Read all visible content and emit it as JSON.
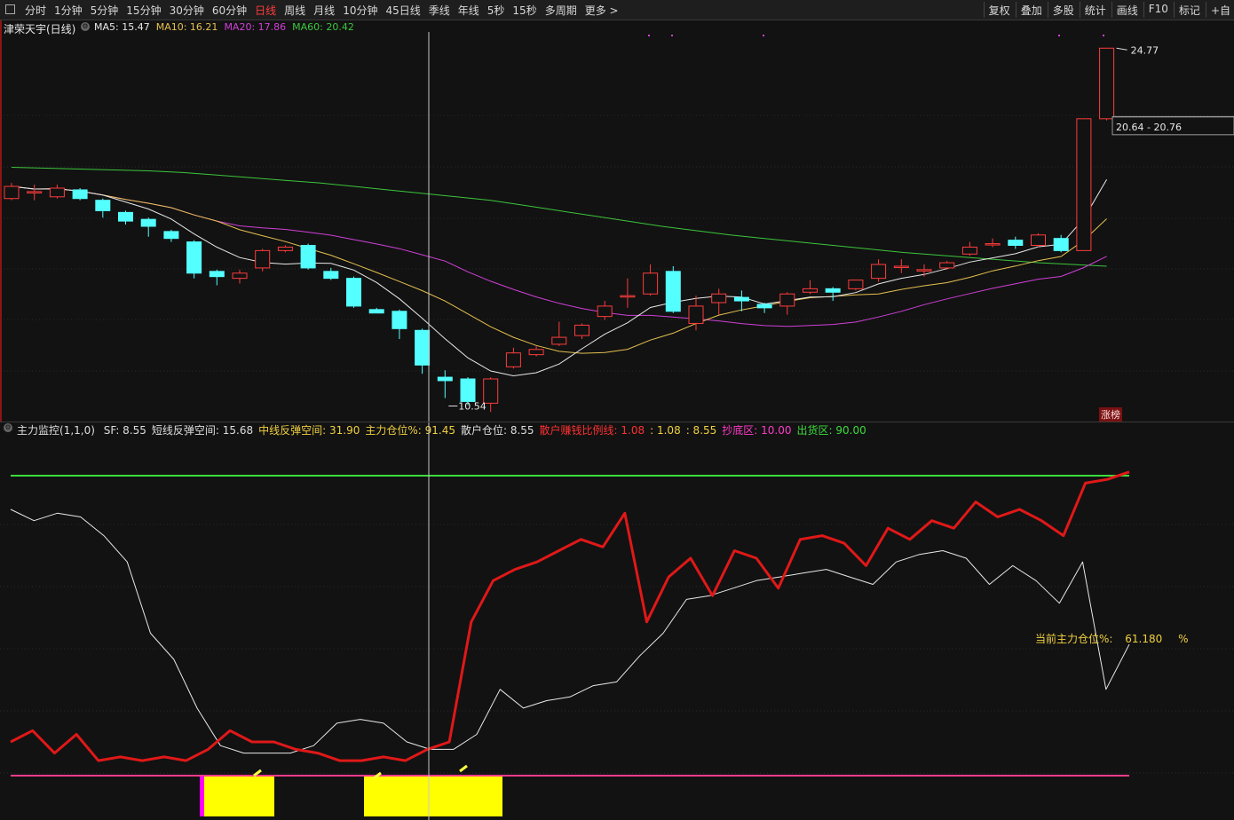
{
  "toolbar": {
    "periods": [
      "分时",
      "1分钟",
      "5分钟",
      "15分钟",
      "30分钟",
      "60分钟",
      "日线",
      "周线",
      "月线",
      "10分钟",
      "45日线",
      "季线",
      "年线",
      "5秒",
      "15秒",
      "多周期",
      "更多 >"
    ],
    "active": "日线",
    "right": [
      "复权",
      "叠加",
      "多股",
      "统计",
      "画线",
      "F10",
      "标记",
      "+自"
    ]
  },
  "main_chart": {
    "title": "津荣天宇(日线)",
    "ma_labels": [
      {
        "text": "MA5: 15.47",
        "color": "#e8e8e8"
      },
      {
        "text": "MA10: 16.21",
        "color": "#e6c050"
      },
      {
        "text": "MA20: 17.86",
        "color": "#d040d8"
      },
      {
        "text": "MA60: 20.42",
        "color": "#3cc63c"
      }
    ],
    "high_label": "24.77",
    "low_label": "10.54",
    "range_label": "20.64 - 20.76",
    "badge": "涨榜",
    "colors": {
      "up": "#ff3c3c",
      "down": "#54ffff",
      "ma5": "#e8e8e8",
      "ma10": "#e6c050",
      "ma20": "#d040d8",
      "ma60": "#3cc63c"
    }
  },
  "indicator": {
    "name": "主力监控(1,1,0)",
    "items": [
      {
        "text": "SF: 8.55",
        "color": "#dddddd"
      },
      {
        "text": "短线反弹空间: 15.68",
        "color": "#dddddd"
      },
      {
        "text": "中线反弹空间: 31.90",
        "color": "#f0d040"
      },
      {
        "text": "主力仓位%: 91.45",
        "color": "#f0d040"
      },
      {
        "text": "散户仓位: 8.55",
        "color": "#dddddd"
      },
      {
        "text": "散户赚钱比例线: 1.08",
        "color": "#ff3030"
      },
      {
        "text": ": 1.08",
        "color": "#f0d040"
      },
      {
        "text": ": 8.55",
        "color": "#f0d040"
      },
      {
        "text": "抄底区: 10.00",
        "color": "#ff3cc8"
      },
      {
        "text": "出货区: 90.00",
        "color": "#3cdc3c"
      }
    ],
    "current_label": "当前主力仓位%:",
    "current_value": "61.180",
    "current_unit": "%"
  },
  "chart_data": [
    {
      "type": "candlestick",
      "title": "津荣天宇(日线)",
      "candles": [
        {
          "o": 16.1,
          "c": 16.8,
          "h": 17.0,
          "l": 16.0
        },
        {
          "o": 16.5,
          "c": 16.5,
          "h": 16.9,
          "l": 16.0
        },
        {
          "o": 16.2,
          "c": 16.7,
          "h": 16.9,
          "l": 16.1
        },
        {
          "o": 16.6,
          "c": 16.1,
          "h": 16.7,
          "l": 16.0
        },
        {
          "o": 16.0,
          "c": 15.4,
          "h": 16.1,
          "l": 15.0
        },
        {
          "o": 15.3,
          "c": 14.8,
          "h": 15.4,
          "l": 14.6
        },
        {
          "o": 14.9,
          "c": 14.5,
          "h": 15.0,
          "l": 13.9
        },
        {
          "o": 14.2,
          "c": 13.8,
          "h": 14.3,
          "l": 13.6
        },
        {
          "o": 13.6,
          "c": 11.8,
          "h": 13.7,
          "l": 11.5
        },
        {
          "o": 11.9,
          "c": 11.6,
          "h": 12.0,
          "l": 11.1
        },
        {
          "o": 11.5,
          "c": 11.8,
          "h": 12.0,
          "l": 11.2
        },
        {
          "o": 12.1,
          "c": 13.1,
          "h": 13.2,
          "l": 11.9
        },
        {
          "o": 13.1,
          "c": 13.3,
          "h": 13.4,
          "l": 13.0
        },
        {
          "o": 13.4,
          "c": 12.1,
          "h": 13.5,
          "l": 12.0
        },
        {
          "o": 11.9,
          "c": 11.5,
          "h": 12.1,
          "l": 11.4
        },
        {
          "o": 11.5,
          "c": 9.9,
          "h": 11.6,
          "l": 9.8
        },
        {
          "o": 9.7,
          "c": 9.5,
          "h": 9.8,
          "l": 9.5
        },
        {
          "o": 9.6,
          "c": 8.6,
          "h": 9.7,
          "l": 8.0
        },
        {
          "o": 8.5,
          "c": 6.5,
          "h": 8.6,
          "l": 6.0
        },
        {
          "o": 5.8,
          "c": 5.6,
          "h": 6.2,
          "l": 4.6
        },
        {
          "o": 5.7,
          "c": 4.4,
          "h": 5.8,
          "l": 4.2
        },
        {
          "o": 4.3,
          "c": 5.7,
          "h": 5.8,
          "l": 3.8
        },
        {
          "o": 6.4,
          "c": 7.2,
          "h": 7.5,
          "l": 6.3
        },
        {
          "o": 7.1,
          "c": 7.4,
          "h": 7.6,
          "l": 7.0
        },
        {
          "o": 7.7,
          "c": 8.1,
          "h": 9.0,
          "l": 7.6
        },
        {
          "o": 8.2,
          "c": 8.8,
          "h": 8.9,
          "l": 8.0
        },
        {
          "o": 9.3,
          "c": 9.9,
          "h": 10.2,
          "l": 9.1
        },
        {
          "o": 10.5,
          "c": 10.5,
          "h": 11.5,
          "l": 9.8
        },
        {
          "o": 10.6,
          "c": 11.8,
          "h": 12.3,
          "l": 10.5
        },
        {
          "o": 11.9,
          "c": 9.6,
          "h": 12.2,
          "l": 9.5
        },
        {
          "o": 8.9,
          "c": 9.9,
          "h": 10.5,
          "l": 8.5
        },
        {
          "o": 10.1,
          "c": 10.6,
          "h": 10.9,
          "l": 9.4
        },
        {
          "o": 10.4,
          "c": 10.2,
          "h": 10.8,
          "l": 9.6
        },
        {
          "o": 10.0,
          "c": 9.8,
          "h": 10.1,
          "l": 9.5
        },
        {
          "o": 9.9,
          "c": 10.6,
          "h": 10.7,
          "l": 9.4
        },
        {
          "o": 10.7,
          "c": 10.9,
          "h": 11.4,
          "l": 10.6
        },
        {
          "o": 10.9,
          "c": 10.7,
          "h": 11.0,
          "l": 10.2
        },
        {
          "o": 10.9,
          "c": 11.4,
          "h": 11.4,
          "l": 10.8
        },
        {
          "o": 11.5,
          "c": 12.3,
          "h": 12.6,
          "l": 11.3
        },
        {
          "o": 12.2,
          "c": 12.2,
          "h": 12.6,
          "l": 11.8
        },
        {
          "o": 12.0,
          "c": 12.0,
          "h": 12.3,
          "l": 11.6
        },
        {
          "o": 12.1,
          "c": 12.4,
          "h": 12.5,
          "l": 12.0
        },
        {
          "o": 12.9,
          "c": 13.3,
          "h": 13.6,
          "l": 12.8
        },
        {
          "o": 13.5,
          "c": 13.5,
          "h": 13.8,
          "l": 13.3
        },
        {
          "o": 13.7,
          "c": 13.4,
          "h": 13.9,
          "l": 13.2
        },
        {
          "o": 13.4,
          "c": 14.0,
          "h": 14.1,
          "l": 13.3
        },
        {
          "o": 13.8,
          "c": 13.1,
          "h": 14.0,
          "l": 13.0
        },
        {
          "o": 13.1,
          "c": 20.7,
          "h": 20.7,
          "l": 13.1
        },
        {
          "o": 20.7,
          "c": 24.77,
          "h": 24.77,
          "l": 20.6
        }
      ],
      "ma60": [
        17.9,
        17.85,
        17.8,
        17.75,
        17.7,
        17.6,
        17.45,
        17.3,
        17.15,
        17.0,
        16.8,
        16.6,
        16.4,
        16.2,
        16.0,
        15.7,
        15.4,
        15.1,
        14.8,
        14.5,
        14.25,
        14.0,
        13.8,
        13.6,
        13.4,
        13.2,
        13.0,
        12.85,
        12.7,
        12.55,
        12.4,
        12.3,
        12.2
      ],
      "ylim": [
        3.5,
        25.5
      ]
    },
    {
      "type": "line",
      "title": "主力监控(1,1,0)",
      "series": [
        {
          "name": "散户仓位",
          "values": [
            81,
            78,
            80,
            79,
            74,
            67,
            48,
            41,
            28,
            18,
            16,
            16,
            16,
            18,
            24,
            25,
            24,
            19,
            17,
            17,
            21,
            33,
            28,
            30,
            31,
            34,
            35,
            42,
            48,
            57,
            58,
            60,
            62,
            63,
            64,
            65,
            63,
            61,
            67,
            69,
            70,
            68,
            61,
            66,
            62,
            56,
            67,
            33,
            45
          ]
        },
        {
          "name": "主力仓位%",
          "values": [
            19,
            22,
            16,
            21,
            14,
            15,
            14,
            15,
            14,
            17,
            22,
            19,
            19,
            17,
            16,
            14,
            14,
            15,
            14,
            17,
            19,
            51,
            62,
            65,
            67,
            70,
            73,
            71,
            80,
            51,
            63,
            68,
            58,
            70,
            68,
            60,
            73,
            74,
            72,
            66,
            76,
            73,
            78,
            76,
            83,
            79,
            81,
            78,
            74,
            88,
            89,
            91
          ]
        }
      ],
      "lines": [
        {
          "name": "出货区",
          "value": 90
        },
        {
          "name": "抄底区",
          "value": 10
        }
      ]
    }
  ]
}
